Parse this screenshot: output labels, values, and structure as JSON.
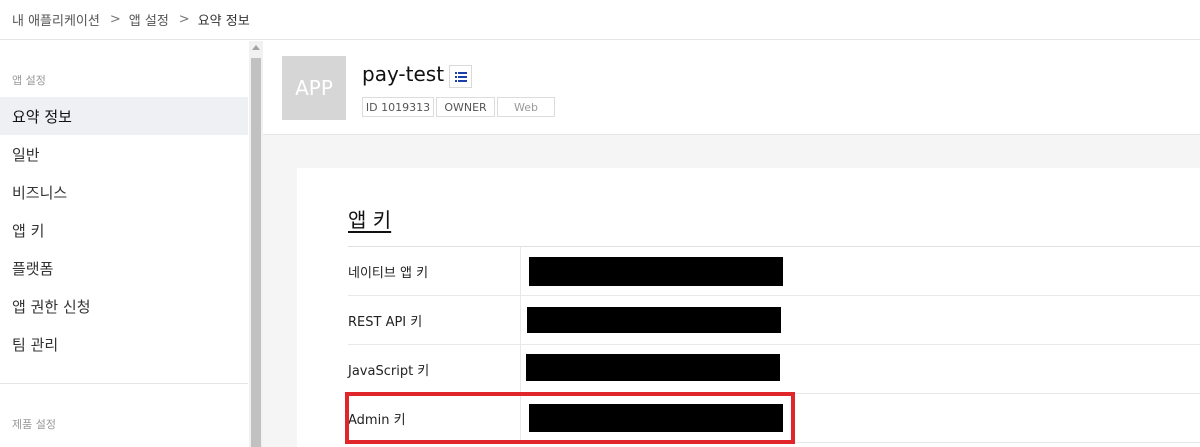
{
  "breadcrumb": {
    "items": [
      "내 애플리케이션",
      "앱 설정",
      "요약 정보"
    ],
    "separator": ">"
  },
  "sidebar": {
    "section1_label": "앱 설정",
    "items": [
      {
        "label": "요약 정보",
        "active": true
      },
      {
        "label": "일반",
        "active": false
      },
      {
        "label": "비즈니스",
        "active": false
      },
      {
        "label": "앱 키",
        "active": false
      },
      {
        "label": "플랫폼",
        "active": false
      },
      {
        "label": "앱 권한 신청",
        "active": false
      },
      {
        "label": "팀 관리",
        "active": false
      }
    ],
    "section2_label": "제품 설정"
  },
  "app": {
    "thumb_text": "APP",
    "name": "pay-test",
    "list_icon": "list-icon",
    "tags": {
      "id": "ID 1019313",
      "role": "OWNER",
      "platform": "Web"
    }
  },
  "app_keys": {
    "title": "앱 키",
    "rows": [
      {
        "label": "네이티브 앱 키",
        "value_state": "redacted"
      },
      {
        "label": "REST API 키",
        "value_state": "redacted"
      },
      {
        "label": "JavaScript 키",
        "value_state": "redacted"
      },
      {
        "label": "Admin 키",
        "value_state": "redacted"
      }
    ]
  },
  "colors": {
    "highlight": "#e0262b",
    "active_bg": "#eef0f4",
    "redaction": "#000000",
    "content_bg": "#f5f5f5"
  }
}
